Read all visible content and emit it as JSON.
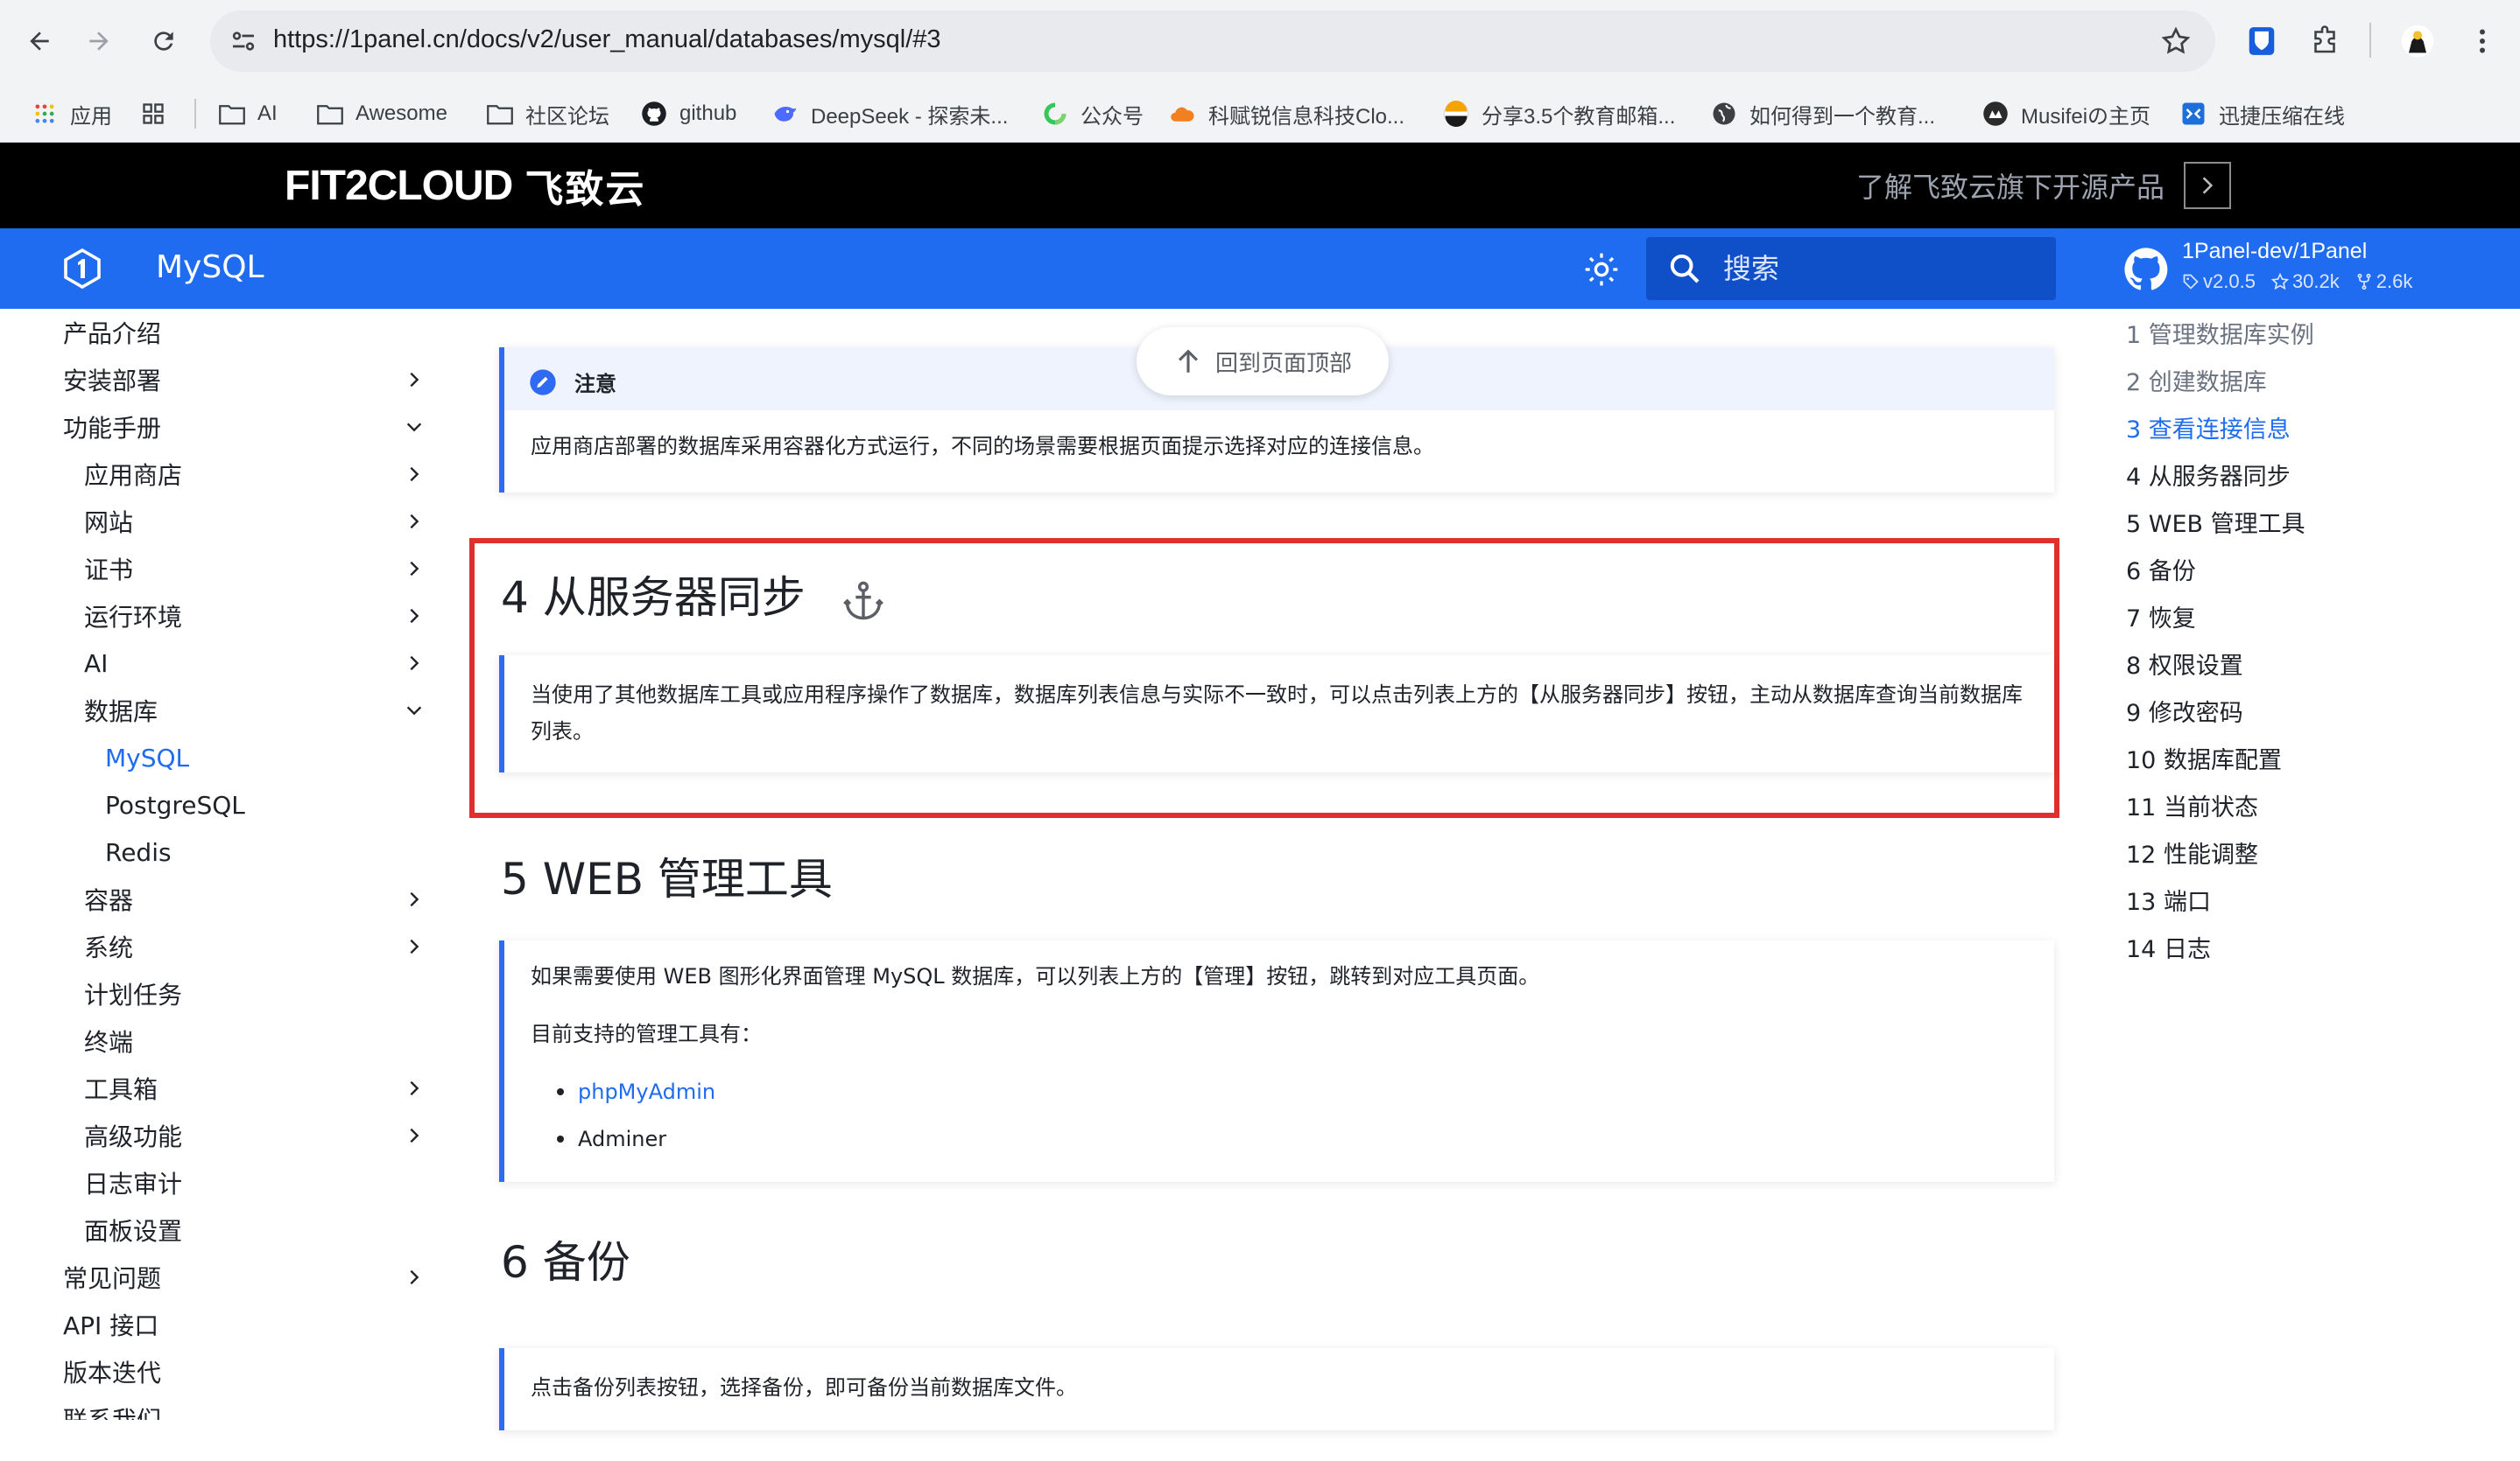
{
  "browser": {
    "url": "https://1panel.cn/docs/v2/user_manual/databases/mysql/#3",
    "bookmarks": [
      {
        "label": "应用",
        "icon": "apps-grid-icon"
      },
      {
        "label": "",
        "icon": "grid-icon"
      },
      {
        "label": "AI",
        "icon": "folder-icon"
      },
      {
        "label": "Awesome",
        "icon": "folder-icon"
      },
      {
        "label": "社区论坛",
        "icon": "folder-icon"
      },
      {
        "label": "github",
        "icon": "github-icon"
      },
      {
        "label": "DeepSeek - 探索未...",
        "icon": "deepseek-icon"
      },
      {
        "label": "公众号",
        "icon": "wechat-icon"
      },
      {
        "label": "科赋锐信息科技Clo...",
        "icon": "cloud-icon"
      },
      {
        "label": "分享3.5个教育邮箱...",
        "icon": "share-icon"
      },
      {
        "label": "如何得到一个教育...",
        "icon": "globe-icon"
      },
      {
        "label": "Musifeiの主页",
        "icon": "avatar-icon"
      },
      {
        "label": "迅捷压缩在线",
        "icon": "compress-icon"
      }
    ]
  },
  "site_header": {
    "logo_text": "FIT2CLOUD",
    "logo_cn": "飞致云",
    "promo": "了解飞致云旗下开源产品"
  },
  "docs_nav": {
    "title": "MySQL",
    "search_placeholder": "搜索",
    "repo": "1Panel-dev/1Panel",
    "version": "v2.0.5",
    "stars": "30.2k",
    "forks": "2.6k"
  },
  "sidebar": {
    "items": [
      {
        "label": "产品介绍"
      },
      {
        "label": "安装部署"
      },
      {
        "label": "功能手册"
      },
      {
        "label": "应用商店"
      },
      {
        "label": "网站"
      },
      {
        "label": "证书"
      },
      {
        "label": "运行环境"
      },
      {
        "label": "AI"
      },
      {
        "label": "数据库"
      },
      {
        "label": "MySQL"
      },
      {
        "label": "PostgreSQL"
      },
      {
        "label": "Redis"
      },
      {
        "label": "容器"
      },
      {
        "label": "系统"
      },
      {
        "label": "计划任务"
      },
      {
        "label": "终端"
      },
      {
        "label": "工具箱"
      },
      {
        "label": "高级功能"
      },
      {
        "label": "日志审计"
      },
      {
        "label": "面板设置"
      },
      {
        "label": "常见问题"
      },
      {
        "label": "API 接口"
      },
      {
        "label": "版本迭代"
      },
      {
        "label": "联系我们"
      }
    ]
  },
  "content": {
    "back_to_top": "回到页面顶部",
    "note": {
      "title": "注意",
      "text": "应用商店部署的数据库采用容器化方式运行，不同的场景需要根据页面提示选择对应的连接信息。"
    },
    "section4": {
      "heading": "4 从服务器同步",
      "text": "当使用了其他数据库工具或应用程序操作了数据库，数据库列表信息与实际不一致时，可以点击列表上方的【从服务器同步】按钮，主动从数据库查询当前数据库列表。"
    },
    "section5": {
      "heading": "5 WEB 管理工具",
      "text1": "如果需要使用 WEB 图形化界面管理 MySQL 数据库，可以列表上方的【管理】按钮，跳转到对应工具页面。",
      "text2": "目前支持的管理工具有：",
      "tools": [
        "phpMyAdmin",
        "Adminer"
      ]
    },
    "section6": {
      "heading": "6 备份",
      "text": "点击备份列表按钮，选择备份，即可备份当前数据库文件。"
    }
  },
  "toc": {
    "items": [
      "1 管理数据库实例",
      "2 创建数据库",
      "3 查看连接信息",
      "4 从服务器同步",
      "5 WEB 管理工具",
      "6 备份",
      "7 恢复",
      "8 权限设置",
      "9 修改密码",
      "10 数据库配置",
      "11 当前状态",
      "12 性能调整",
      "13 端口",
      "14 日志"
    ]
  },
  "colors": {
    "brand_blue": "#1f6cf0",
    "highlight_red": "#e0302c",
    "header_black": "#000000"
  }
}
